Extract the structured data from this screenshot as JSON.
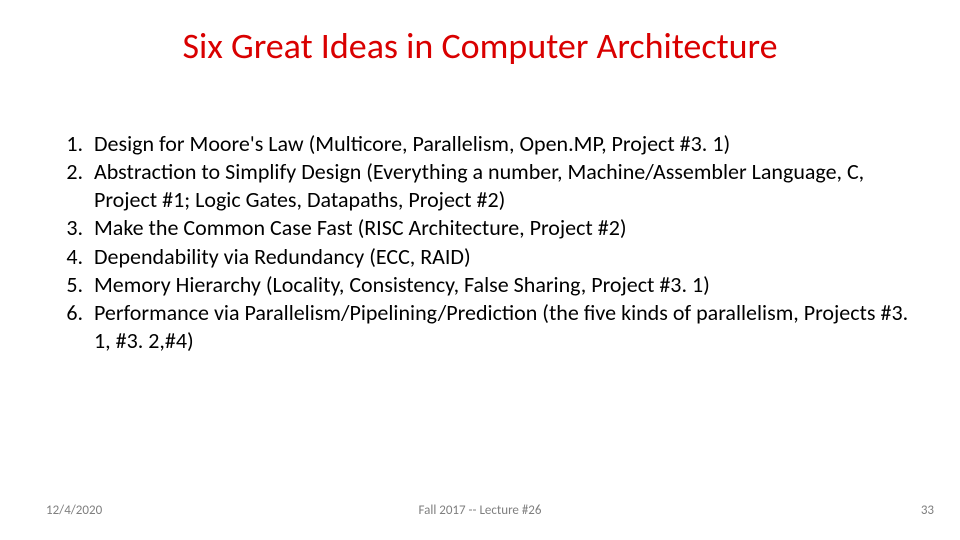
{
  "title": "Six Great Ideas in Computer Architecture",
  "ideas": [
    "Design for Moore's Law (Multicore, Parallelism, Open.MP, Project #3. 1)",
    "Abstraction to Simplify Design (Everything a number, Machine/Assembler Language, C, Project #1; Logic Gates, Datapaths, Project #2)",
    "Make the Common Case Fast (RISC Architecture, Project #2)",
    "Dependability via Redundancy (ECC, RAID)",
    "Memory Hierarchy (Locality, Consistency, False Sharing, Project #3. 1)",
    "Performance via Parallelism/Pipelining/Prediction (the five kinds of parallelism, Projects #3. 1, #3. 2,#4)"
  ],
  "footer": {
    "date": "12/4/2020",
    "center": "Fall 2017 -- Lecture #26",
    "page": "33"
  }
}
